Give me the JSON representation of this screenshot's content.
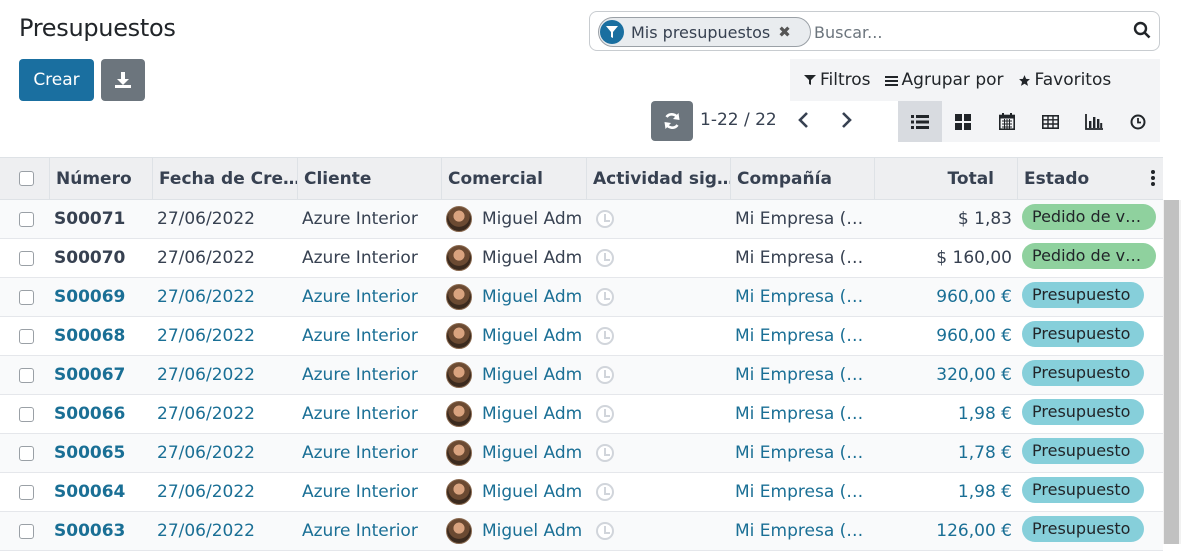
{
  "page": {
    "title": "Presupuestos"
  },
  "toolbar": {
    "create_label": "Crear",
    "download_icon": "download-icon"
  },
  "search": {
    "facet_label": "Mis presupuestos",
    "facet_close": "✖",
    "placeholder": "Buscar..."
  },
  "filters": {
    "filtros": "Filtros",
    "agrupar": "Agrupar por",
    "favoritos": "Favoritos"
  },
  "pager": {
    "value": "1-22 / 22"
  },
  "views": [
    "list-view-icon",
    "kanban-view-icon",
    "calendar-view-icon",
    "pivot-view-icon",
    "graph-view-icon",
    "activity-view-icon"
  ],
  "table": {
    "headers": {
      "numero": "Número",
      "fecha": "Fecha de Cre…",
      "cliente": "Cliente",
      "comercial": "Comercial",
      "actividad": "Actividad sig…",
      "compania": "Compañía",
      "total": "Total",
      "estado": "Estado"
    },
    "rows": [
      {
        "numero": "S00071",
        "fecha": "27/06/2022",
        "cliente": "Azure Interior",
        "comercial": "Miguel Adm",
        "compania": "Mi Empresa (…",
        "total": "$ 1,83",
        "estado": "Pedido de v…"
      },
      {
        "numero": "S00070",
        "fecha": "27/06/2022",
        "cliente": "Azure Interior",
        "comercial": "Miguel Adm",
        "compania": "Mi Empresa (…",
        "total": "$ 160,00",
        "estado": "Pedido de v…"
      },
      {
        "numero": "S00069",
        "fecha": "27/06/2022",
        "cliente": "Azure Interior",
        "comercial": "Miguel Adm",
        "compania": "Mi Empresa (…",
        "total": "960,00 €",
        "estado": "Presupuesto"
      },
      {
        "numero": "S00068",
        "fecha": "27/06/2022",
        "cliente": "Azure Interior",
        "comercial": "Miguel Adm",
        "compania": "Mi Empresa (…",
        "total": "960,00 €",
        "estado": "Presupuesto"
      },
      {
        "numero": "S00067",
        "fecha": "27/06/2022",
        "cliente": "Azure Interior",
        "comercial": "Miguel Adm",
        "compania": "Mi Empresa (…",
        "total": "320,00 €",
        "estado": "Presupuesto"
      },
      {
        "numero": "S00066",
        "fecha": "27/06/2022",
        "cliente": "Azure Interior",
        "comercial": "Miguel Adm",
        "compania": "Mi Empresa (…",
        "total": "1,98 €",
        "estado": "Presupuesto"
      },
      {
        "numero": "S00065",
        "fecha": "27/06/2022",
        "cliente": "Azure Interior",
        "comercial": "Miguel Adm",
        "compania": "Mi Empresa (…",
        "total": "1,78 €",
        "estado": "Presupuesto"
      },
      {
        "numero": "S00064",
        "fecha": "27/06/2022",
        "cliente": "Azure Interior",
        "comercial": "Miguel Adm",
        "compania": "Mi Empresa (…",
        "total": "1,98 €",
        "estado": "Presupuesto"
      },
      {
        "numero": "S00063",
        "fecha": "27/06/2022",
        "cliente": "Azure Interior",
        "comercial": "Miguel Adm",
        "compania": "Mi Empresa (…",
        "total": "126,00 €",
        "estado": "Presupuesto"
      }
    ]
  },
  "colors": {
    "primary": "#1a6fa0",
    "link": "#1a6f95",
    "sale_badge": "#8fd19e",
    "quote_badge": "#86cfda"
  }
}
